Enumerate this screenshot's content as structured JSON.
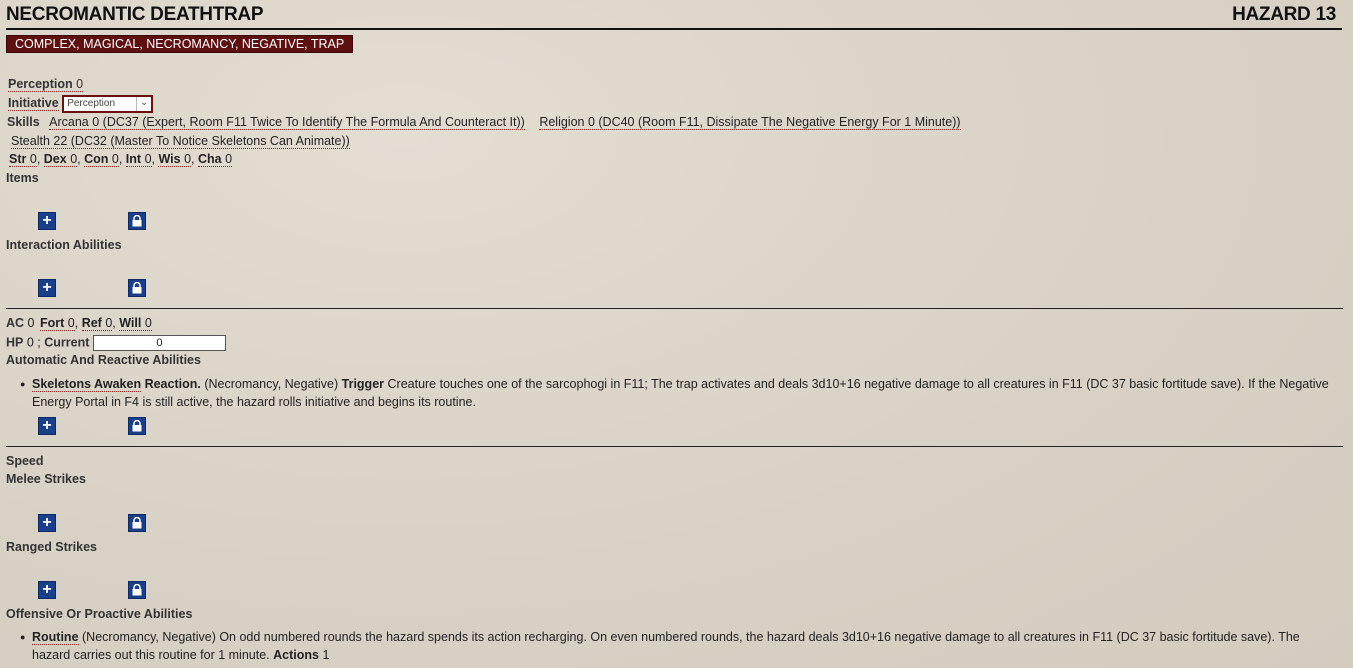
{
  "header": {
    "title": "NECROMANTIC DEATHTRAP",
    "level": "HAZARD 13"
  },
  "traits": "COMPLEX, MAGICAL, NECROMANCY, NEGATIVE, TRAP",
  "perception": {
    "label": "Perception",
    "value": "0"
  },
  "initiative": {
    "label": "Initiative",
    "selected": "Perception"
  },
  "skills": {
    "label": "Skills",
    "arcana": "Arcana 0 (DC37 (Expert, Room F11 Twice To Identify The Formula And Counteract It))",
    "religion": "Religion 0 (DC40 (Room F11, Dissipate The Negative Energy For 1 Minute))",
    "stealth": "Stealth 22 (DC32 (Master To Notice Skeletons Can Animate))"
  },
  "abilities": [
    {
      "label": "Str",
      "value": "0"
    },
    {
      "label": "Dex",
      "value": "0"
    },
    {
      "label": "Con",
      "value": "0"
    },
    {
      "label": "Int",
      "value": "0"
    },
    {
      "label": "Wis",
      "value": "0"
    },
    {
      "label": "Cha",
      "value": "0"
    }
  ],
  "sections": {
    "items": "Items",
    "interaction": "Interaction Abilities",
    "automatic": "Automatic And Reactive Abilities",
    "speed": "Speed",
    "melee": "Melee Strikes",
    "ranged": "Ranged Strikes",
    "offensive": "Offensive Or Proactive Abilities"
  },
  "defense": {
    "ac_label": "AC",
    "ac": "0",
    "fort_label": "Fort",
    "fort": "0",
    "ref_label": "Ref",
    "ref": "0",
    "will_label": "Will",
    "will": "0",
    "hp_label": "HP",
    "hp": "0",
    "current_label": "Current",
    "current": "0"
  },
  "reaction": {
    "name": "Skeletons Awaken",
    "kind": "Reaction.",
    "traits": "(Necromancy, Negative)",
    "trigger_label": "Trigger",
    "text": "Creature touches one of the sarcophogi in F11; The trap activates and deals 3d10+16 negative damage to all creatures in F11 (DC 37 basic fortitude save). If the Negative Energy Portal in F4 is still active, the hazard rolls initiative and begins its routine."
  },
  "routine": {
    "name": "Routine",
    "text": "(Necromancy, Negative) On odd numbered rounds the hazard spends its action recharging. On even numbered rounds, the hazard deals 3d10+16 negative damage to all creatures in F11 (DC 37 basic fortitude save). The hazard carries out this routine for 1 minute.",
    "actions_label": "Actions",
    "actions": "1"
  },
  "icons": {
    "add": "plus-icon",
    "lock": "lock-icon"
  },
  "colors": {
    "accent": "#5e1010",
    "button": "#1a3f8a"
  }
}
